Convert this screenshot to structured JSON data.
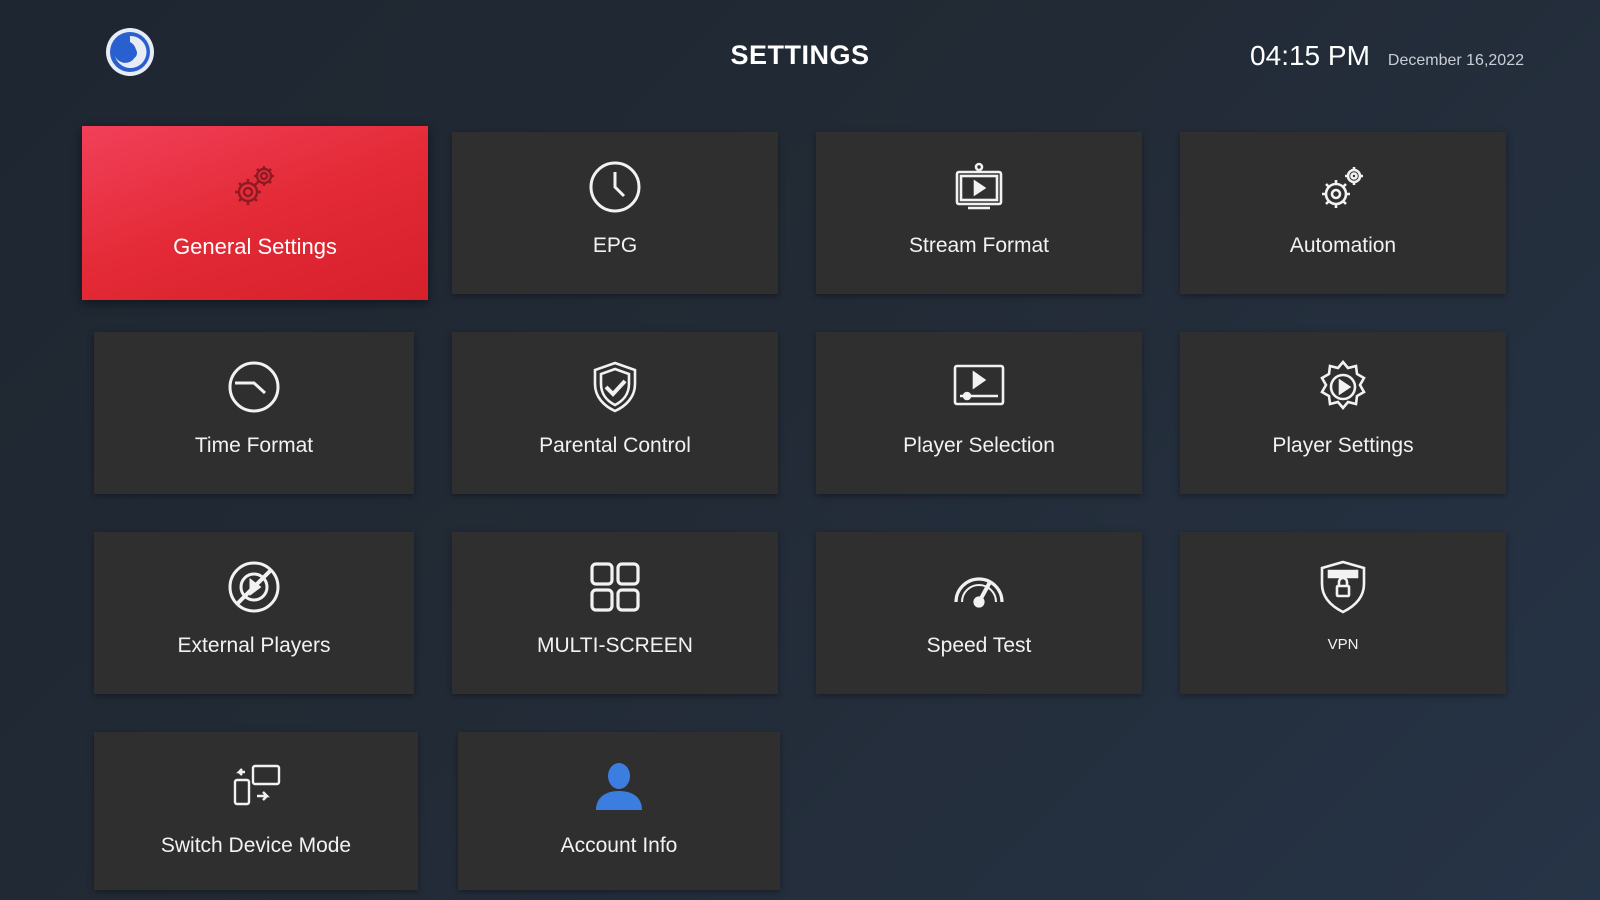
{
  "header": {
    "title": "SETTINGS",
    "time": "04:15 PM",
    "date": "December 16,2022"
  },
  "colors": {
    "selected_tile": "#e32a36",
    "tile": "#2f2f30",
    "account_icon": "#3b7ee0",
    "selected_icon": "#8e1a22"
  },
  "tiles": [
    {
      "label": "General Settings",
      "icon": "gears-icon",
      "selected": true
    },
    {
      "label": "EPG",
      "icon": "clock-icon"
    },
    {
      "label": "Stream Format",
      "icon": "stream-format-icon"
    },
    {
      "label": "Automation",
      "icon": "automation-gears-icon"
    },
    {
      "label": "Time Format",
      "icon": "time-format-icon"
    },
    {
      "label": "Parental Control",
      "icon": "shield-check-icon"
    },
    {
      "label": "Player Selection",
      "icon": "player-selection-icon"
    },
    {
      "label": "Player Settings",
      "icon": "player-settings-icon"
    },
    {
      "label": "External Players",
      "icon": "external-players-icon"
    },
    {
      "label": "MULTI-SCREEN",
      "icon": "multi-screen-grid-icon"
    },
    {
      "label": "Speed Test",
      "icon": "speedometer-icon"
    },
    {
      "label": "VPN",
      "icon": "vpn-shield-icon"
    },
    {
      "label": "Switch Device Mode",
      "icon": "switch-device-icon"
    },
    {
      "label": "Account Info",
      "icon": "user-icon"
    }
  ]
}
